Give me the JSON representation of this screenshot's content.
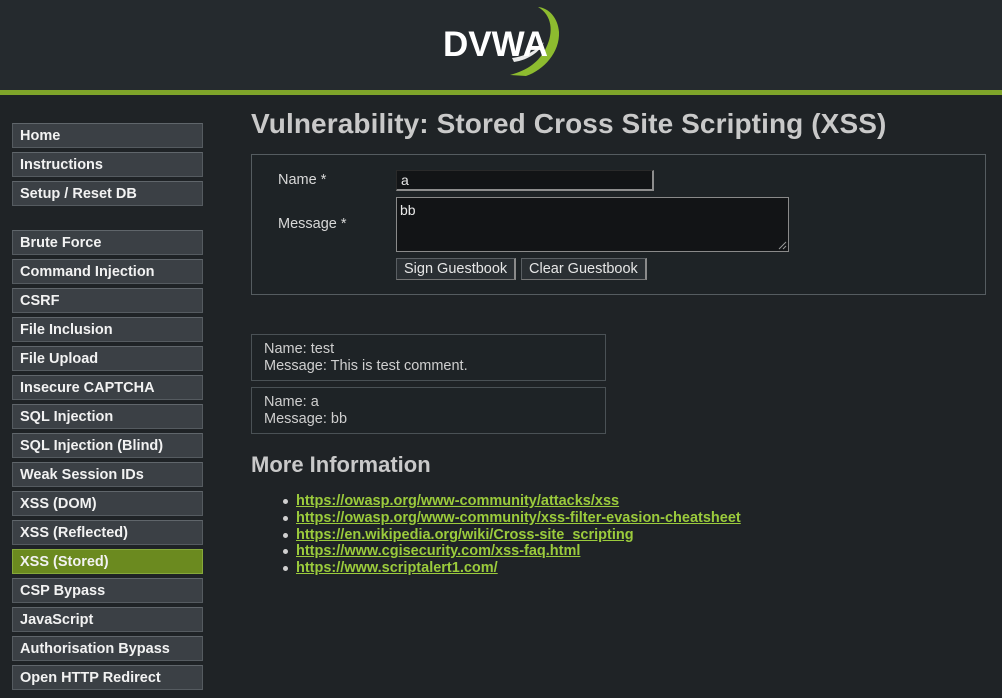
{
  "header": {
    "logo_text": "DVWA"
  },
  "colors": {
    "accent": "#7fa52a",
    "active_menu": "#6b8a1f",
    "link": "#9bcb3c",
    "background": "#1f2326"
  },
  "sidebar": {
    "items": [
      {
        "label": "Home"
      },
      {
        "label": "Instructions"
      },
      {
        "label": "Setup / Reset DB"
      },
      {
        "label": "Brute Force"
      },
      {
        "label": "Command Injection"
      },
      {
        "label": "CSRF"
      },
      {
        "label": "File Inclusion"
      },
      {
        "label": "File Upload"
      },
      {
        "label": "Insecure CAPTCHA"
      },
      {
        "label": "SQL Injection"
      },
      {
        "label": "SQL Injection (Blind)"
      },
      {
        "label": "Weak Session IDs"
      },
      {
        "label": "XSS (DOM)"
      },
      {
        "label": "XSS (Reflected)"
      },
      {
        "label": "XSS (Stored)",
        "active": true
      },
      {
        "label": "CSP Bypass"
      },
      {
        "label": "JavaScript"
      },
      {
        "label": "Authorisation Bypass"
      },
      {
        "label": "Open HTTP Redirect"
      }
    ]
  },
  "main": {
    "title": "Vulnerability: Stored Cross Site Scripting (XSS)",
    "form": {
      "name_label": "Name *",
      "name_value": "a",
      "message_label": "Message *",
      "message_value": "bb",
      "sign_button": "Sign Guestbook",
      "clear_button": "Clear Guestbook"
    },
    "entries": [
      {
        "name": "Name: test",
        "message": "Message: This is test comment."
      },
      {
        "name": "Name: a",
        "message": "Message: bb"
      }
    ],
    "more_info_heading": "More Information",
    "links": [
      "https://owasp.org/www-community/attacks/xss",
      "https://owasp.org/www-community/xss-filter-evasion-cheatsheet",
      "https://en.wikipedia.org/wiki/Cross-site_scripting",
      "https://www.cgisecurity.com/xss-faq.html",
      "https://www.scriptalert1.com/"
    ]
  }
}
